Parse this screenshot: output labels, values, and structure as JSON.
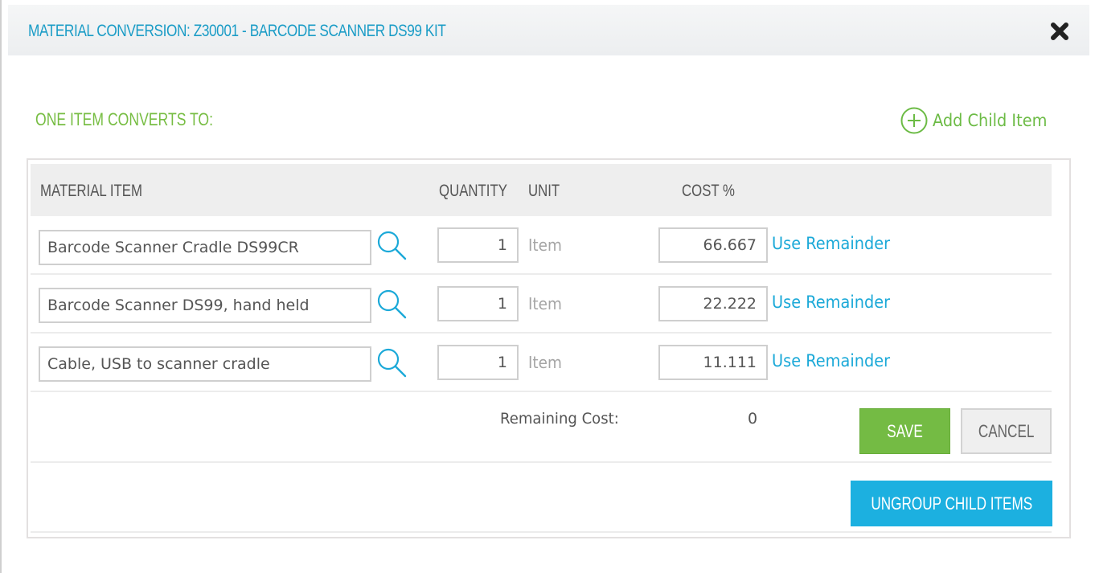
{
  "dialog": {
    "title": "MATERIAL CONVERSION: Z30001 - BARCODE SCANNER DS99 KIT",
    "close_icon": "close-icon"
  },
  "section": {
    "label": "ONE ITEM CONVERTS TO:",
    "add_child_label": "Add Child Item",
    "add_child_icon": "plus-circle-icon"
  },
  "table": {
    "columns": {
      "material_item": "MATERIAL ITEM",
      "quantity": "QUANTITY",
      "unit": "UNIT",
      "cost_pct": "COST %"
    },
    "rows": [
      {
        "material_item": "Barcode Scanner Cradle DS99CR",
        "quantity": "1",
        "unit": "Item",
        "cost_pct": "66.667",
        "action": "Use Remainder"
      },
      {
        "material_item": "Barcode Scanner DS99, hand held",
        "quantity": "1",
        "unit": "Item",
        "cost_pct": "22.222",
        "action": "Use Remainder"
      },
      {
        "material_item": "Cable, USB to scanner cradle",
        "quantity": "1",
        "unit": "Item",
        "cost_pct": "11.111",
        "action": "Use Remainder"
      }
    ],
    "remaining_cost_label": "Remaining Cost:",
    "remaining_cost_value": "0"
  },
  "buttons": {
    "save": "SAVE",
    "cancel": "CANCEL",
    "ungroup": "UNGROUP CHILD ITEMS"
  },
  "colors": {
    "title_blue": "#1a9cc6",
    "accent_green": "#74bb44",
    "link_blue": "#1ba9d8",
    "ungroup_blue": "#1cb0e0"
  }
}
